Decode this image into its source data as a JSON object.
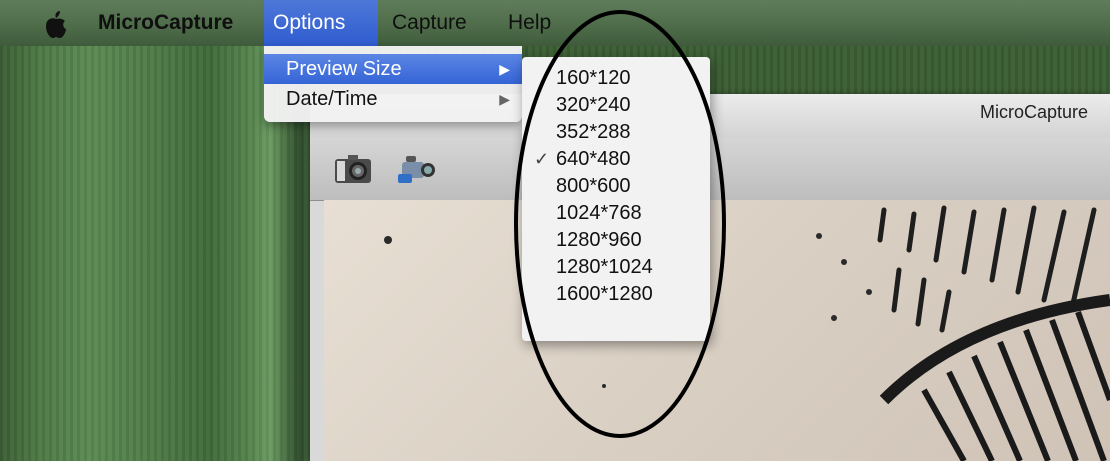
{
  "menubar": {
    "apple_icon": "apple-logo",
    "app_name": "MicroCapture",
    "options": "Options",
    "capture": "Capture",
    "help": "Help"
  },
  "options_menu": {
    "items": [
      {
        "label": "Preview Size",
        "selected": true
      },
      {
        "label": "Date/Time",
        "selected": false
      }
    ]
  },
  "preview_size_submenu": {
    "items": [
      {
        "label": "160*120",
        "checked": false
      },
      {
        "label": "320*240",
        "checked": false
      },
      {
        "label": "352*288",
        "checked": false
      },
      {
        "label": "640*480",
        "checked": true
      },
      {
        "label": "800*600",
        "checked": false
      },
      {
        "label": "1024*768",
        "checked": false
      },
      {
        "label": "1280*960",
        "checked": false
      },
      {
        "label": "1280*1024",
        "checked": false
      },
      {
        "label": "1600*1280",
        "checked": false
      }
    ],
    "checkmark": "✓"
  },
  "window": {
    "title": "MicroCapture",
    "toolbar": {
      "photo_icon": "camera-icon",
      "video_icon": "video-camera-icon"
    }
  },
  "colors": {
    "menu_highlight": "#3a6ad8",
    "annotation": "#000000"
  }
}
